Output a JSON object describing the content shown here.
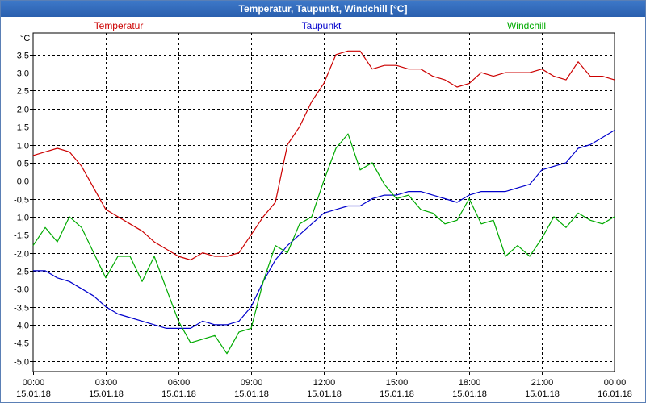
{
  "window": {
    "title": "Temperatur, Taupunkt, Windchill [°C]"
  },
  "chart_data": {
    "type": "line",
    "title": "Temperatur, Taupunkt, Windchill [°C]",
    "ylabel": "°C",
    "xlim": [
      "15.01.18 00:00",
      "16.01.18 00:00"
    ],
    "ylim": [
      -5.3,
      4.1
    ],
    "grid": true,
    "legend_position": "top",
    "x_tick_labels": [
      {
        "time": "00:00",
        "date": "15.01.18"
      },
      {
        "time": "03:00",
        "date": "15.01.18"
      },
      {
        "time": "06:00",
        "date": "15.01.18"
      },
      {
        "time": "09:00",
        "date": "15.01.18"
      },
      {
        "time": "12:00",
        "date": "15.01.18"
      },
      {
        "time": "15:00",
        "date": "15.01.18"
      },
      {
        "time": "18:00",
        "date": "15.01.18"
      },
      {
        "time": "21:00",
        "date": "15.01.18"
      },
      {
        "time": "00:00",
        "date": "16.01.18"
      }
    ],
    "y_tick_labels": [
      "3,5",
      "3,0",
      "2,5",
      "2,0",
      "1,5",
      "1,0",
      "0,5",
      "0,0",
      "-0,5",
      "-1,0",
      "-1,5",
      "-2,0",
      "-2,5",
      "-3,0",
      "-3,5",
      "-4,0",
      "-4,5",
      "-5,0"
    ],
    "y_ticks": [
      3.5,
      3.0,
      2.5,
      2.0,
      1.5,
      1.0,
      0.5,
      0.0,
      -0.5,
      -1.0,
      -1.5,
      -2.0,
      -2.5,
      -3.0,
      -3.5,
      -4.0,
      -4.5,
      -5.0
    ],
    "series": [
      {
        "name": "Temperatur",
        "color": "#cc0000",
        "x": [
          "15.01.18 00:00",
          "15.01.18 00:30",
          "15.01.18 01:00",
          "15.01.18 01:30",
          "15.01.18 02:00",
          "15.01.18 02:30",
          "15.01.18 03:00",
          "15.01.18 03:30",
          "15.01.18 04:00",
          "15.01.18 04:30",
          "15.01.18 05:00",
          "15.01.18 05:30",
          "15.01.18 06:00",
          "15.01.18 06:30",
          "15.01.18 07:00",
          "15.01.18 07:30",
          "15.01.18 08:00",
          "15.01.18 08:30",
          "15.01.18 09:00",
          "15.01.18 09:30",
          "15.01.18 10:00",
          "15.01.18 10:30",
          "15.01.18 11:00",
          "15.01.18 11:30",
          "15.01.18 12:00",
          "15.01.18 12:30",
          "15.01.18 13:00",
          "15.01.18 13:30",
          "15.01.18 14:00",
          "15.01.18 14:30",
          "15.01.18 15:00",
          "15.01.18 15:30",
          "15.01.18 16:00",
          "15.01.18 16:30",
          "15.01.18 17:00",
          "15.01.18 17:30",
          "15.01.18 18:00",
          "15.01.18 18:30",
          "15.01.18 19:00",
          "15.01.18 19:30",
          "15.01.18 20:00",
          "15.01.18 20:30",
          "15.01.18 21:00",
          "15.01.18 21:30",
          "15.01.18 22:00",
          "15.01.18 22:30",
          "15.01.18 23:00",
          "15.01.18 23:30",
          "16.01.18 00:00"
        ],
        "y": [
          0.7,
          0.8,
          0.9,
          0.8,
          0.4,
          -0.2,
          -0.8,
          -1.0,
          -1.2,
          -1.4,
          -1.7,
          -1.9,
          -2.1,
          -2.2,
          -2.0,
          -2.1,
          -2.1,
          -2.0,
          -1.5,
          -1.0,
          -0.6,
          1.0,
          1.5,
          2.2,
          2.7,
          3.5,
          3.6,
          3.6,
          3.1,
          3.2,
          3.2,
          3.1,
          3.1,
          2.9,
          2.8,
          2.6,
          2.7,
          3.0,
          2.9,
          3.0,
          3.0,
          3.0,
          3.1,
          2.9,
          2.8,
          3.3,
          2.9,
          2.9,
          2.8
        ]
      },
      {
        "name": "Taupunkt",
        "color": "#0000cc",
        "x": [
          "15.01.18 00:00",
          "15.01.18 00:30",
          "15.01.18 01:00",
          "15.01.18 01:30",
          "15.01.18 02:00",
          "15.01.18 02:30",
          "15.01.18 03:00",
          "15.01.18 03:30",
          "15.01.18 04:00",
          "15.01.18 04:30",
          "15.01.18 05:00",
          "15.01.18 05:30",
          "15.01.18 06:00",
          "15.01.18 06:30",
          "15.01.18 07:00",
          "15.01.18 07:30",
          "15.01.18 08:00",
          "15.01.18 08:30",
          "15.01.18 09:00",
          "15.01.18 09:30",
          "15.01.18 10:00",
          "15.01.18 10:30",
          "15.01.18 11:00",
          "15.01.18 11:30",
          "15.01.18 12:00",
          "15.01.18 12:30",
          "15.01.18 13:00",
          "15.01.18 13:30",
          "15.01.18 14:00",
          "15.01.18 14:30",
          "15.01.18 15:00",
          "15.01.18 15:30",
          "15.01.18 16:00",
          "15.01.18 16:30",
          "15.01.18 17:00",
          "15.01.18 17:30",
          "15.01.18 18:00",
          "15.01.18 18:30",
          "15.01.18 19:00",
          "15.01.18 19:30",
          "15.01.18 20:00",
          "15.01.18 20:30",
          "15.01.18 21:00",
          "15.01.18 21:30",
          "15.01.18 22:00",
          "15.01.18 22:30",
          "15.01.18 23:00",
          "15.01.18 23:30",
          "16.01.18 00:00"
        ],
        "y": [
          -2.5,
          -2.5,
          -2.7,
          -2.8,
          -3.0,
          -3.2,
          -3.5,
          -3.7,
          -3.8,
          -3.9,
          -4.0,
          -4.1,
          -4.1,
          -4.1,
          -3.9,
          -4.0,
          -4.0,
          -3.9,
          -3.5,
          -2.8,
          -2.2,
          -1.8,
          -1.5,
          -1.2,
          -0.9,
          -0.8,
          -0.7,
          -0.7,
          -0.5,
          -0.4,
          -0.4,
          -0.3,
          -0.3,
          -0.4,
          -0.5,
          -0.6,
          -0.4,
          -0.3,
          -0.3,
          -0.3,
          -0.2,
          -0.1,
          0.3,
          0.4,
          0.5,
          0.9,
          1.0,
          1.2,
          1.4
        ]
      },
      {
        "name": "Windchill",
        "color": "#00aa00",
        "x": [
          "15.01.18 00:00",
          "15.01.18 00:30",
          "15.01.18 01:00",
          "15.01.18 01:30",
          "15.01.18 02:00",
          "15.01.18 02:30",
          "15.01.18 03:00",
          "15.01.18 03:30",
          "15.01.18 04:00",
          "15.01.18 04:30",
          "15.01.18 05:00",
          "15.01.18 05:30",
          "15.01.18 06:00",
          "15.01.18 06:30",
          "15.01.18 07:00",
          "15.01.18 07:30",
          "15.01.18 08:00",
          "15.01.18 08:30",
          "15.01.18 09:00",
          "15.01.18 09:30",
          "15.01.18 10:00",
          "15.01.18 10:30",
          "15.01.18 11:00",
          "15.01.18 11:30",
          "15.01.18 12:00",
          "15.01.18 12:30",
          "15.01.18 13:00",
          "15.01.18 13:30",
          "15.01.18 14:00",
          "15.01.18 14:30",
          "15.01.18 15:00",
          "15.01.18 15:30",
          "15.01.18 16:00",
          "15.01.18 16:30",
          "15.01.18 17:00",
          "15.01.18 17:30",
          "15.01.18 18:00",
          "15.01.18 18:30",
          "15.01.18 19:00",
          "15.01.18 19:30",
          "15.01.18 20:00",
          "15.01.18 20:30",
          "15.01.18 21:00",
          "15.01.18 21:30",
          "15.01.18 22:00",
          "15.01.18 22:30",
          "15.01.18 23:00",
          "15.01.18 23:30",
          "16.01.18 00:00"
        ],
        "y": [
          -1.8,
          -1.3,
          -1.7,
          -1.0,
          -1.3,
          -2.0,
          -2.7,
          -2.1,
          -2.1,
          -2.8,
          -2.1,
          -3.0,
          -3.9,
          -4.5,
          -4.4,
          -4.3,
          -4.8,
          -4.2,
          -4.1,
          -2.8,
          -1.8,
          -2.0,
          -1.2,
          -1.0,
          0.0,
          0.9,
          1.3,
          0.3,
          0.5,
          -0.1,
          -0.5,
          -0.4,
          -0.8,
          -0.9,
          -1.2,
          -1.1,
          -0.5,
          -1.2,
          -1.1,
          -2.1,
          -1.8,
          -2.1,
          -1.6,
          -1.0,
          -1.3,
          -0.9,
          -1.1,
          -1.2,
          -1.0
        ]
      }
    ]
  }
}
